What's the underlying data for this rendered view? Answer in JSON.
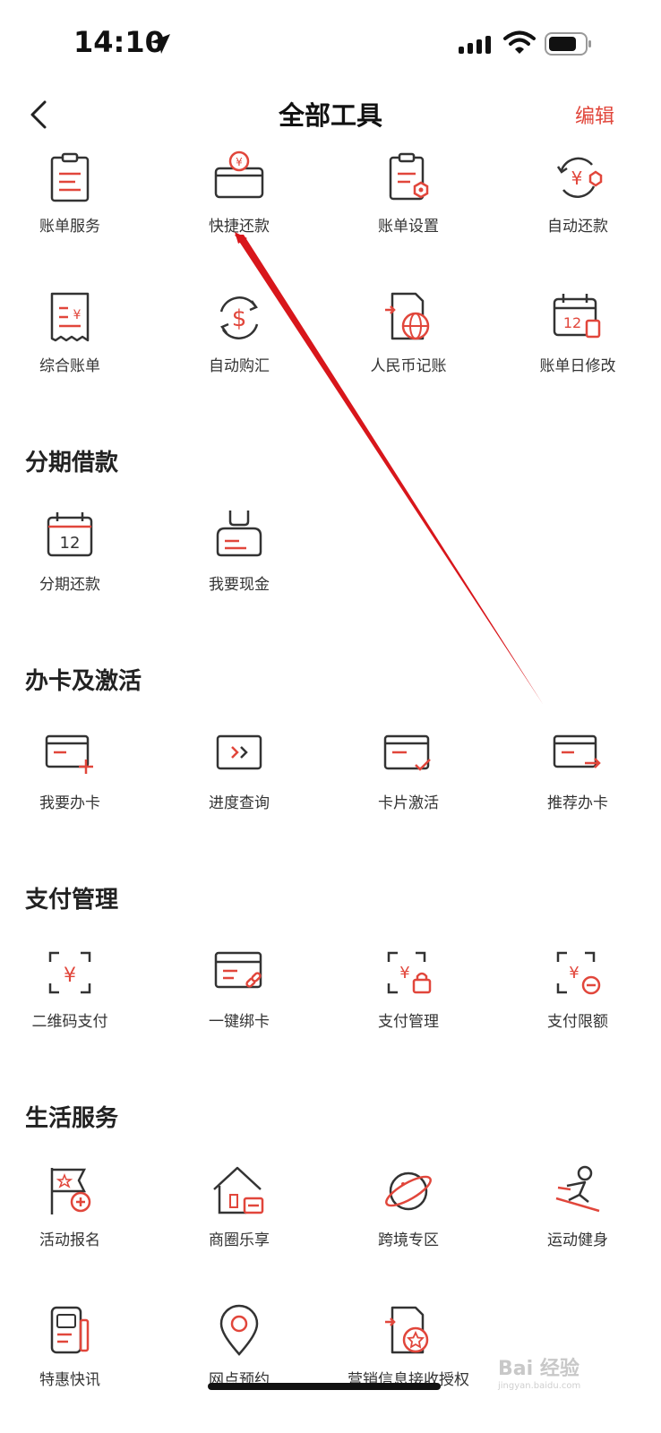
{
  "status_bar": {
    "time": "14:10"
  },
  "header": {
    "title": "全部工具",
    "edit_label": "编辑"
  },
  "sections": [
    {
      "title": "",
      "items": [
        {
          "label": "账单服务",
          "icon": "bill-clipboard-icon"
        },
        {
          "label": "快捷还款",
          "icon": "quick-repay-wallet-icon"
        },
        {
          "label": "账单设置",
          "icon": "bill-settings-icon"
        },
        {
          "label": "自动还款",
          "icon": "auto-repay-icon"
        },
        {
          "label": "综合账单",
          "icon": "receipt-yuan-icon"
        },
        {
          "label": "自动购汇",
          "icon": "auto-exchange-dollar-icon"
        },
        {
          "label": "人民币记账",
          "icon": "rmb-accounting-globe-icon"
        },
        {
          "label": "账单日修改",
          "icon": "bill-date-calendar-icon"
        }
      ]
    },
    {
      "title": "分期借款",
      "items": [
        {
          "label": "分期还款",
          "icon": "installment-calendar-icon"
        },
        {
          "label": "我要现金",
          "icon": "cash-bag-icon"
        }
      ]
    },
    {
      "title": "办卡及激活",
      "items": [
        {
          "label": "我要办卡",
          "icon": "card-add-icon"
        },
        {
          "label": "进度查询",
          "icon": "progress-card-icon"
        },
        {
          "label": "卡片激活",
          "icon": "card-activate-icon"
        },
        {
          "label": "推荐办卡",
          "icon": "card-recommend-icon"
        }
      ]
    },
    {
      "title": "支付管理",
      "items": [
        {
          "label": "二维码支付",
          "icon": "qr-pay-icon"
        },
        {
          "label": "一键绑卡",
          "icon": "card-bind-link-icon"
        },
        {
          "label": "支付管理",
          "icon": "pay-manage-lock-icon"
        },
        {
          "label": "支付限额",
          "icon": "pay-limit-icon"
        }
      ]
    },
    {
      "title": "生活服务",
      "items": [
        {
          "label": "活动报名",
          "icon": "event-flag-icon"
        },
        {
          "label": "商圈乐享",
          "icon": "shop-house-icon"
        },
        {
          "label": "跨境专区",
          "icon": "cross-border-planet-icon"
        },
        {
          "label": "运动健身",
          "icon": "sports-skiing-icon"
        },
        {
          "label": "特惠快讯",
          "icon": "news-card-icon"
        },
        {
          "label": "网点预约",
          "icon": "location-pin-icon"
        },
        {
          "label": "营销信息接收授权",
          "icon": "marketing-auth-icon"
        }
      ]
    }
  ],
  "watermark": {
    "brand": "Bai 经验",
    "url": "jingyan.baidu.com"
  },
  "colors": {
    "accent": "#e1463b",
    "icon_stroke": "#333333",
    "icon_red": "#e1463b"
  }
}
